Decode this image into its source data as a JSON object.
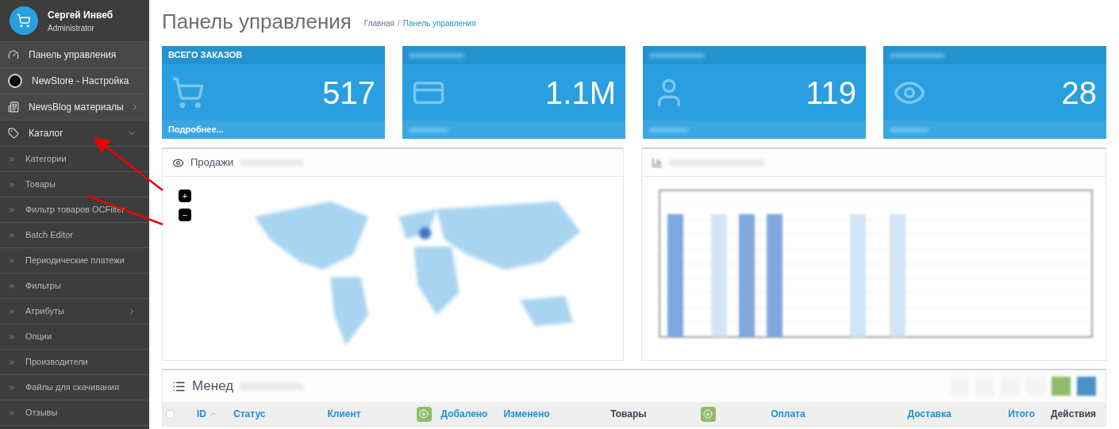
{
  "user": {
    "name": "Сергей Инвеб",
    "role": "Administrator"
  },
  "sidebar": {
    "items": [
      {
        "label": "Панель управления"
      },
      {
        "label": "NewStore - Настройка"
      },
      {
        "label": "NewsBlog материалы",
        "expanded": false
      },
      {
        "label": "Каталог",
        "expanded": true,
        "children": [
          {
            "label": "Категории"
          },
          {
            "label": "Товары"
          },
          {
            "label": "Фильтр товаров OCFilter"
          },
          {
            "label": "Batch Editor"
          },
          {
            "label": "Периодические платежи"
          },
          {
            "label": "Фильтры"
          },
          {
            "label": "Атрибуты",
            "expanded": false
          },
          {
            "label": "Опции"
          },
          {
            "label": "Производители"
          },
          {
            "label": "Файлы для скачивания"
          },
          {
            "label": "Отзывы"
          }
        ]
      }
    ]
  },
  "page": {
    "title": "Панель управления",
    "breadcrumbs": [
      {
        "label": "Главная",
        "selected": false
      },
      {
        "label": "Панель управления",
        "selected": true
      }
    ],
    "breadcrumb_separator": "/"
  },
  "cards": [
    {
      "title": "ВСЕГО ЗАКАЗОВ",
      "value": "517",
      "footer": "Подробнее..."
    },
    {
      "value": "1.1M"
    },
    {
      "value": "119"
    },
    {
      "value": "28"
    }
  ],
  "map_panel": {
    "title": "Продажи",
    "zoom_buttons": [
      "+",
      "−"
    ]
  },
  "orders_panel": {
    "title": "Менед",
    "columns": [
      {
        "kind": "checkbox",
        "checked": false
      },
      {
        "kind": "text",
        "label": "ID",
        "link": true,
        "sorted": true
      },
      {
        "kind": "text",
        "label": "Статус",
        "link": true
      },
      {
        "kind": "text",
        "label": "Клиент",
        "link": true
      },
      {
        "kind": "icon-button"
      },
      {
        "kind": "text",
        "label": "Добалено",
        "link": true
      },
      {
        "kind": "text",
        "label": "Изменено",
        "link": true
      },
      {
        "kind": "text",
        "label": "Товары",
        "link": false
      },
      {
        "kind": "icon-button"
      },
      {
        "kind": "text",
        "label": "Оплата",
        "link": true
      },
      {
        "kind": "text",
        "label": "Доставка",
        "link": true
      },
      {
        "kind": "text",
        "label": "Итого",
        "link": true
      },
      {
        "kind": "text",
        "label": "Действия",
        "link": false
      }
    ]
  }
}
